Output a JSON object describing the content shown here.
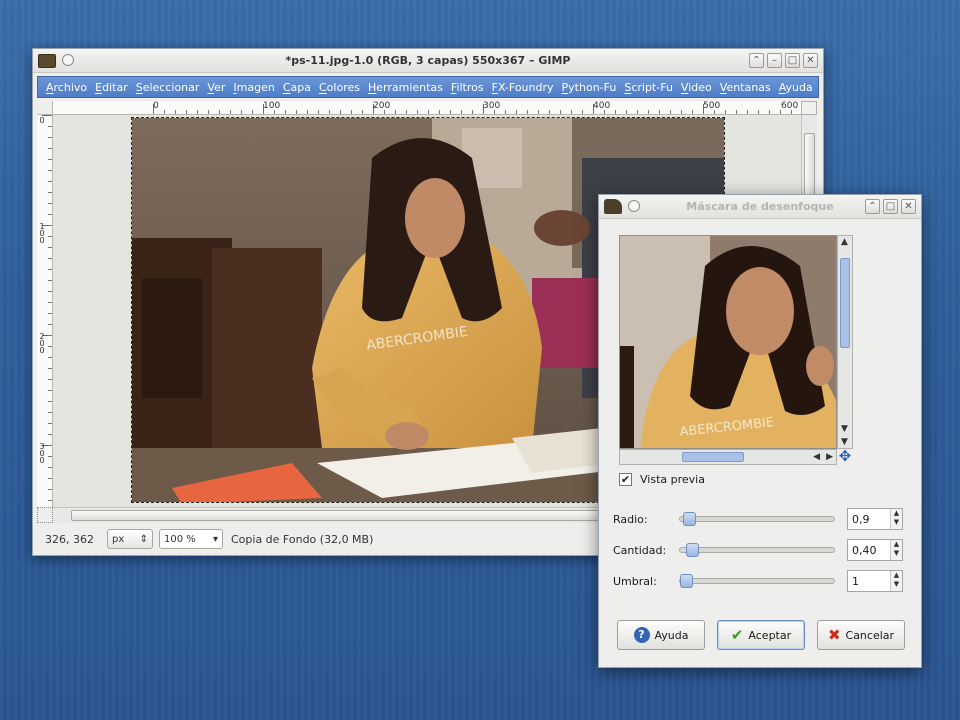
{
  "main_window": {
    "title": "*ps-11.jpg-1.0 (RGB, 3 capas) 550x367 – GIMP",
    "menu": [
      "Archivo",
      "Editar",
      "Seleccionar",
      "Ver",
      "Imagen",
      "Capa",
      "Colores",
      "Herramientas",
      "Filtros",
      "FX-Foundry",
      "Python-Fu",
      "Script-Fu",
      "Video",
      "Ventanas",
      "Ayuda"
    ],
    "ruler_h": [
      "0",
      "100",
      "200",
      "300",
      "400",
      "500",
      "600"
    ],
    "ruler_v": [
      "0",
      "100",
      "200",
      "300"
    ],
    "status": {
      "coords": "326, 362",
      "unit": "px",
      "zoom": "100 %",
      "layer_info": "Copia de Fondo (32,0 MB)"
    }
  },
  "dialog": {
    "title": "Máscara de desenfoque",
    "preview_label": "Vista previa",
    "preview_checked": true,
    "params": [
      {
        "label": "Radio:",
        "value": "0,9",
        "fraction": 0.02
      },
      {
        "label": "Cantidad:",
        "value": "0,40",
        "fraction": 0.04
      },
      {
        "label": "Umbral:",
        "value": "1",
        "fraction": 0.0
      }
    ],
    "buttons": {
      "help": "Ayuda",
      "ok": "Aceptar",
      "cancel": "Cancelar"
    }
  },
  "colors": {
    "menubar": "#4e7dc8",
    "accent": "#a9c1e6",
    "ok": "#3c9b27",
    "cancel": "#d02b20"
  }
}
